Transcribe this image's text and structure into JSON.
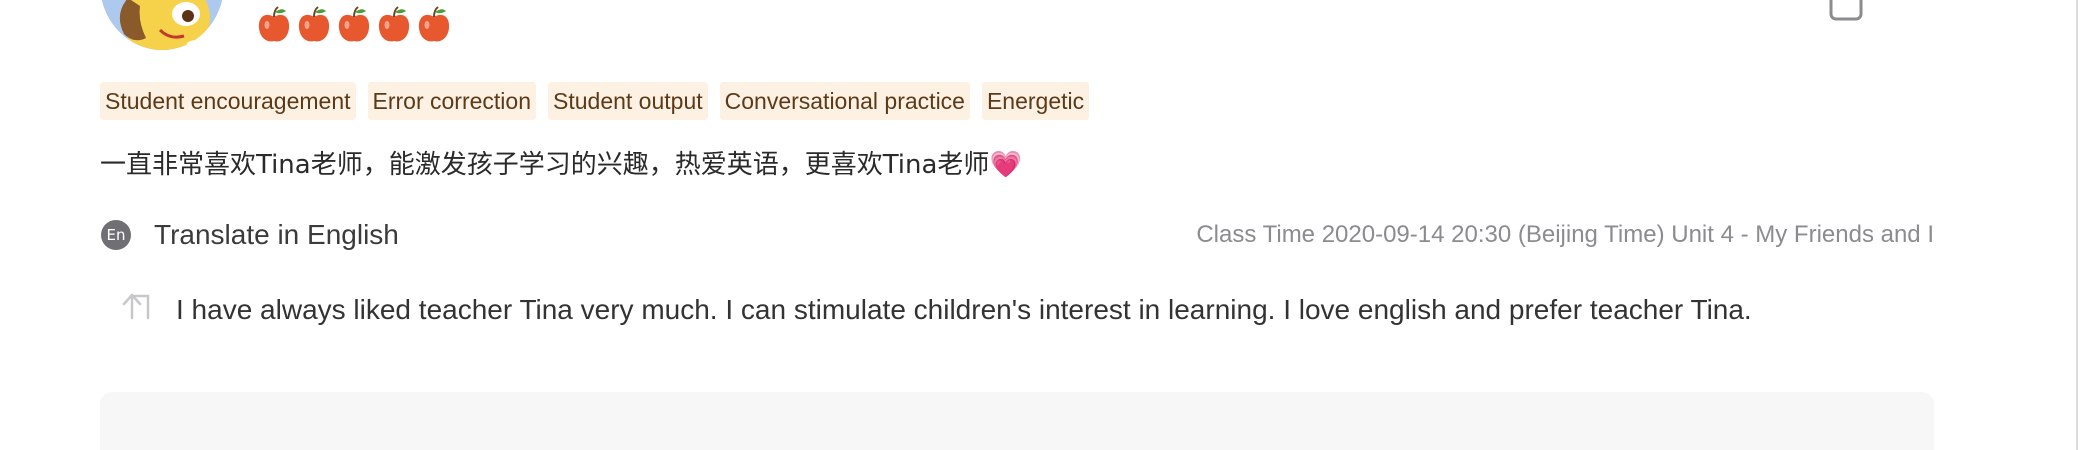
{
  "rating": {
    "icon": "apple-icon",
    "count": 5,
    "color": "#e8582e"
  },
  "tags": [
    "Student encouragement",
    "Error correction",
    "Student output",
    "Conversational practice",
    "Energetic"
  ],
  "review": {
    "text": "一直非常喜欢Tina老师，能激发孩子学习的兴趣，热爱英语，更喜欢Tina老师",
    "emoji": "💗"
  },
  "translate": {
    "badge": "En",
    "label": "Translate in English"
  },
  "class_time": "Class Time 2020-09-14 20:30 (Beijing Time) Unit 4 - My Friends and I",
  "translation": "I have always liked teacher Tina very much. I can stimulate children's interest in learning. I love english and prefer teacher Tina.",
  "colors": {
    "tag_bg": "#fdf1e4",
    "tag_text": "#5c3a17",
    "muted_text": "#8b8b90",
    "apple": "#e8582e"
  }
}
